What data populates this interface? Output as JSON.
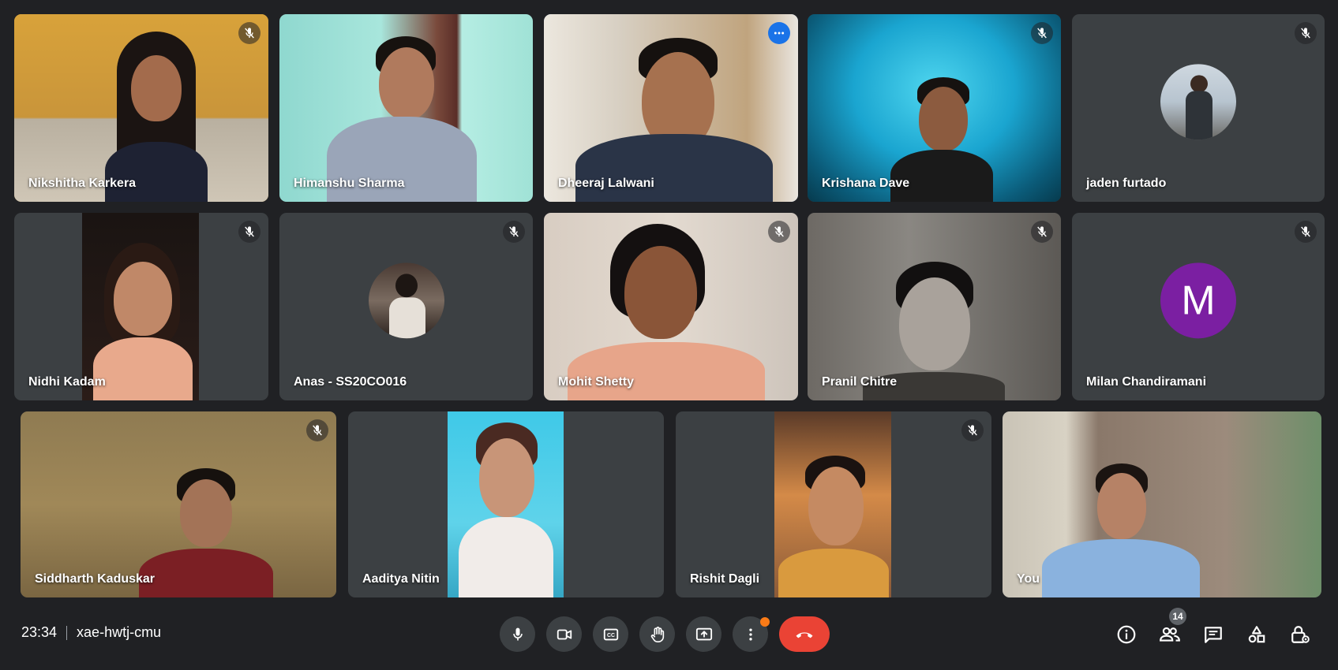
{
  "participants": [
    {
      "name": "Nikshitha Karkera",
      "muted": true
    },
    {
      "name": "Himanshu Sharma",
      "muted": false
    },
    {
      "name": "Dheeraj Lalwani",
      "muted": false,
      "speaking": true
    },
    {
      "name": "Krishana Dave",
      "muted": true
    },
    {
      "name": "jaden furtado",
      "muted": true,
      "avatar": "photo-avatar"
    },
    {
      "name": "Nidhi Kadam",
      "muted": true
    },
    {
      "name": "Anas - SS20CO016",
      "muted": true,
      "avatar": "photo-avatar"
    },
    {
      "name": "Mohit Shetty",
      "muted": true
    },
    {
      "name": "Pranil Chitre",
      "muted": true
    },
    {
      "name": "Milan Chandiramani",
      "muted": true,
      "avatar_initial": "M"
    },
    {
      "name": "Siddharth Kaduskar",
      "muted": true
    },
    {
      "name": "Aaditya Nitin",
      "muted": false
    },
    {
      "name": "Rishit Dagli",
      "muted": true
    },
    {
      "name": "You",
      "muted": false
    }
  ],
  "meeting": {
    "time": "23:34",
    "code": "xae-hwtj-cmu"
  },
  "controls": {
    "mic": "microphone-icon",
    "camera": "camera-icon",
    "captions": "closed-captions-icon",
    "raise_hand": "raise-hand-icon",
    "present": "present-screen-icon",
    "more": "more-options-icon",
    "end_call": "end-call-icon"
  },
  "side_controls": {
    "info": "info-icon",
    "people_count": "14",
    "chat": "chat-icon",
    "activities": "activities-icon",
    "host": "host-controls-icon"
  },
  "colors": {
    "background": "#202124",
    "tile": "#3c4043",
    "speaking_outline": "#8ab4f8",
    "end_call": "#ea4335",
    "initial_avatar": "#7b1fa2"
  }
}
